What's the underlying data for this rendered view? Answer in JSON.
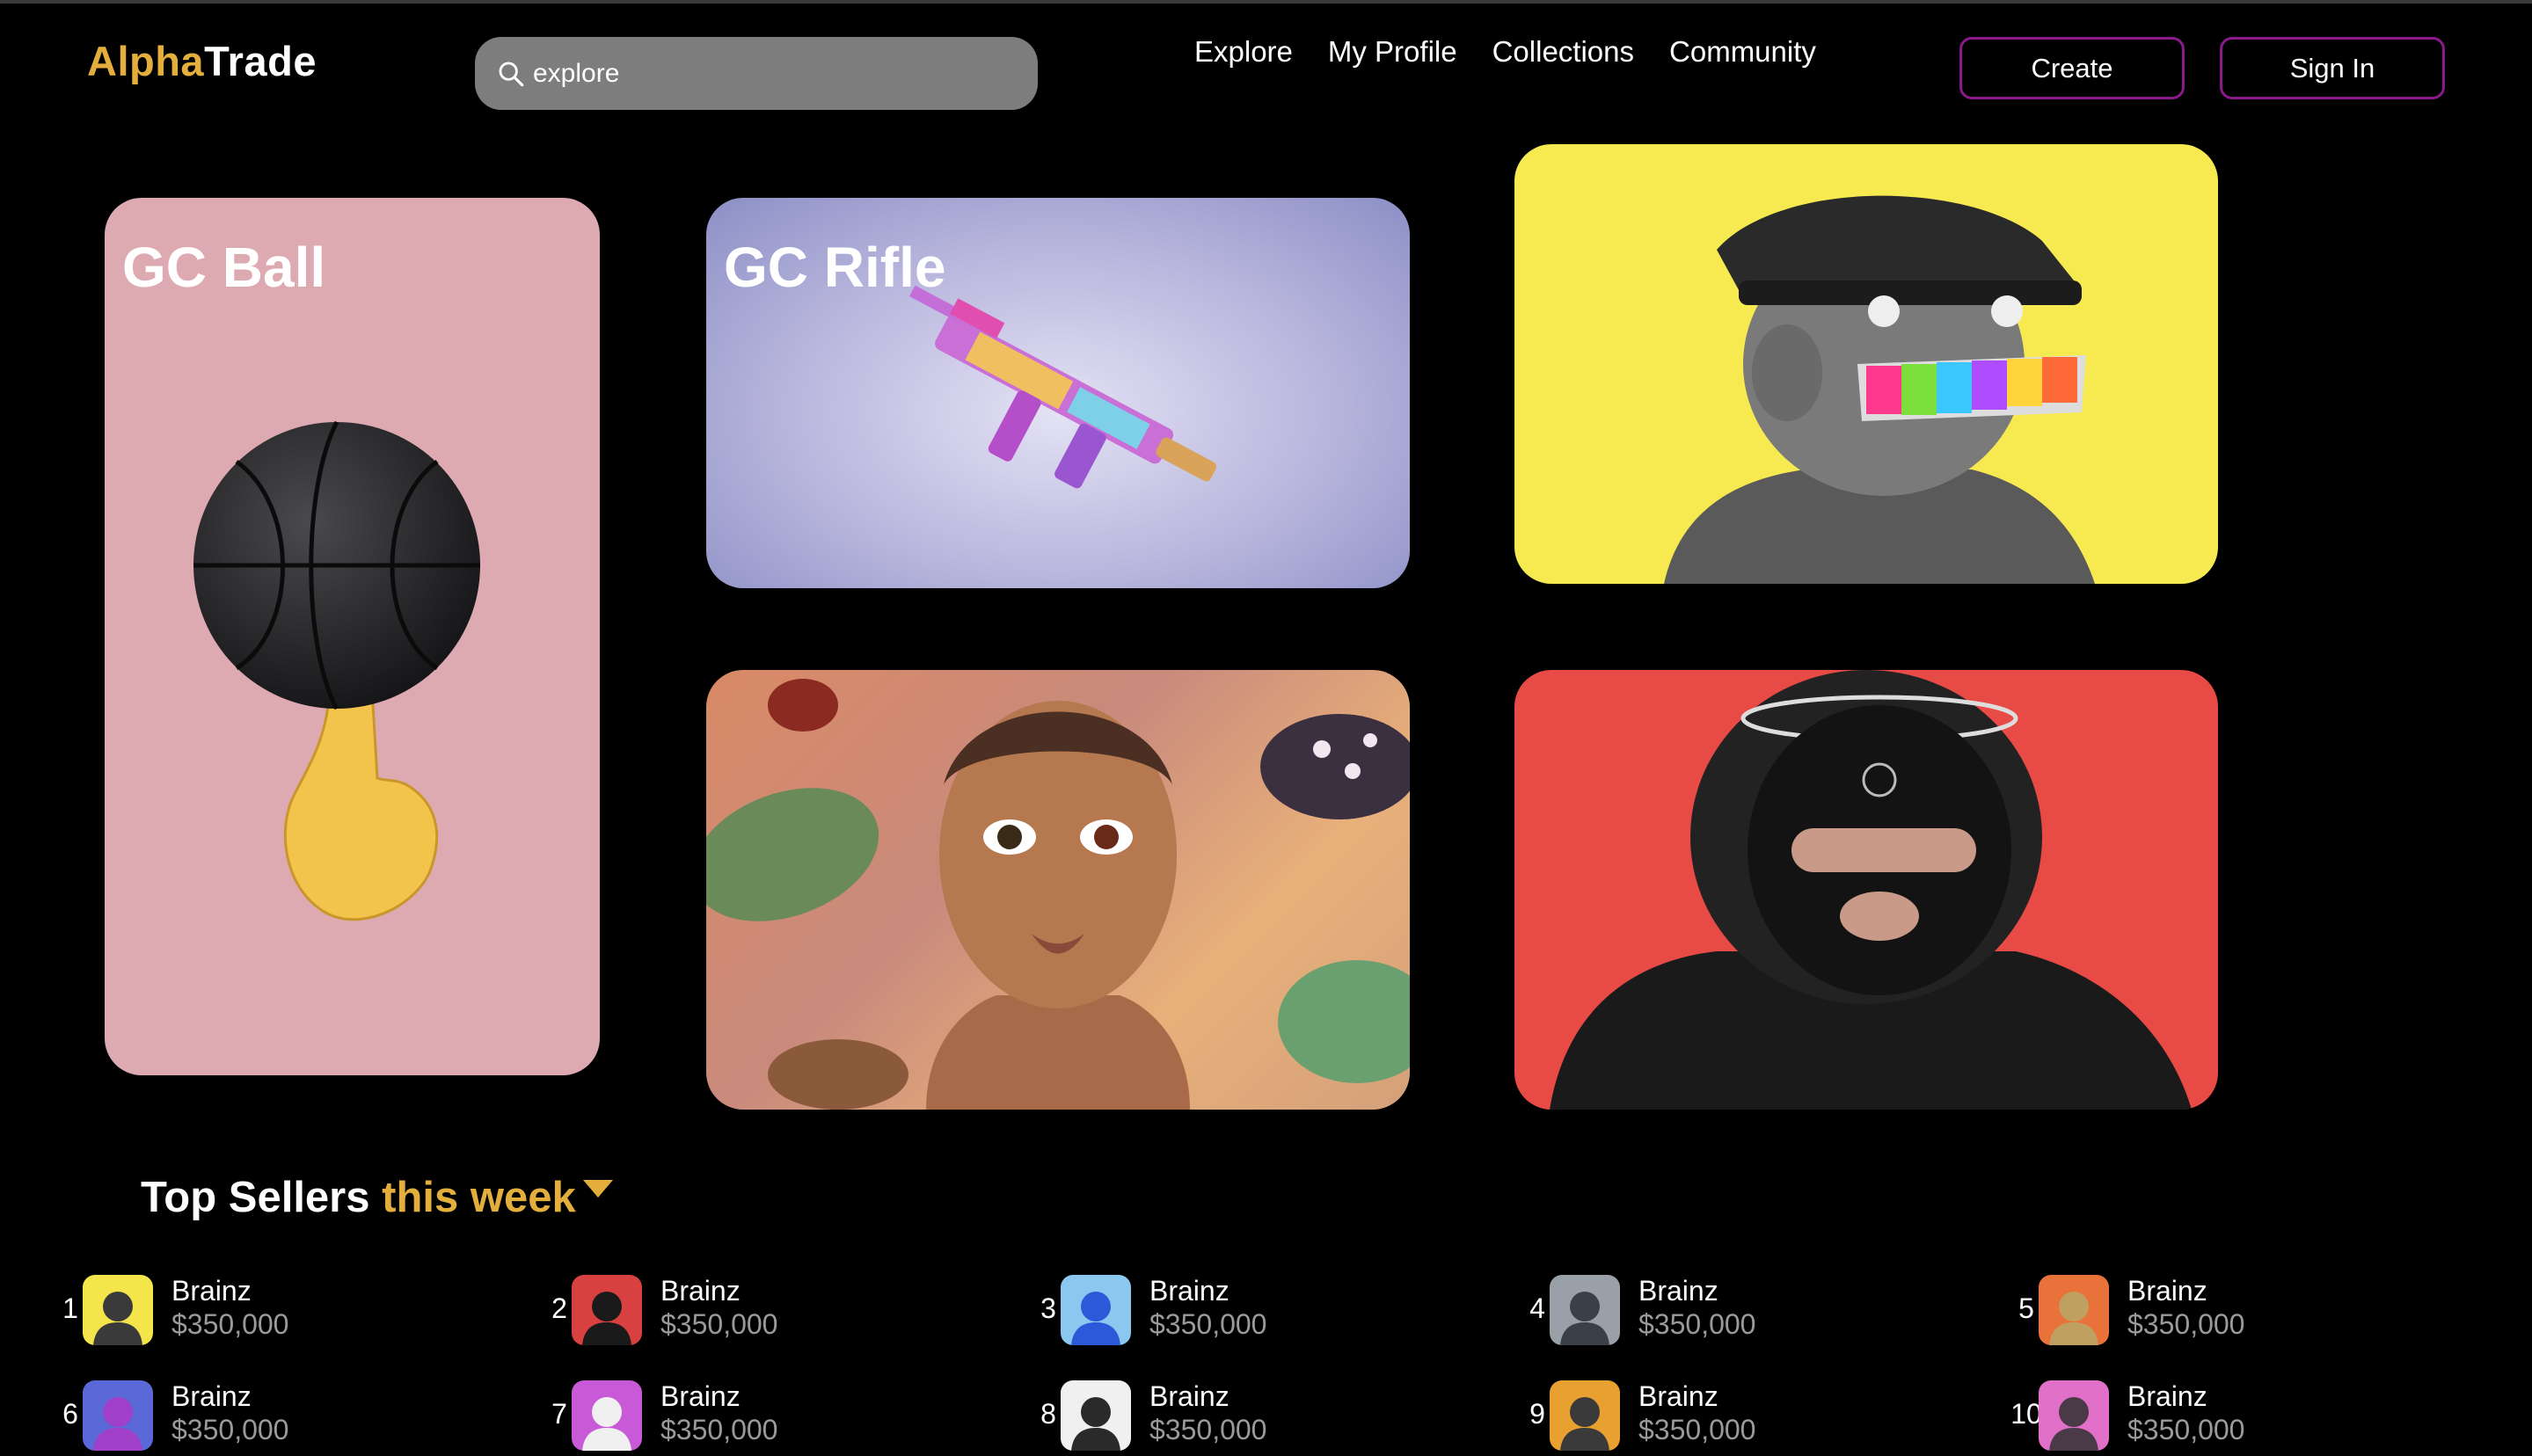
{
  "colors": {
    "accent": "#e3ae3c",
    "button_border": "#8a1a8c",
    "background": "#000000"
  },
  "header": {
    "logo_part1": "Alpha",
    "logo_part2": "Trade",
    "search": {
      "value": "explore",
      "placeholder": "explore",
      "icon": "search-icon"
    },
    "nav": [
      "Explore",
      "My Profile",
      "Collections",
      "Community"
    ],
    "create_label": "Create",
    "signin_label": "Sign In"
  },
  "featured": {
    "ball": {
      "title": "GC Ball"
    },
    "rifle": {
      "title": "GC Rifle"
    }
  },
  "top_sellers": {
    "title_main": "Top Sellers",
    "title_highlight": "this week",
    "sellers": [
      {
        "rank": "1",
        "name": "Brainz",
        "price": "$350,000"
      },
      {
        "rank": "2",
        "name": "Brainz",
        "price": "$350,000"
      },
      {
        "rank": "3",
        "name": "Brainz",
        "price": "$350,000"
      },
      {
        "rank": "4",
        "name": "Brainz",
        "price": "$350,000"
      },
      {
        "rank": "5",
        "name": "Brainz",
        "price": "$350,000"
      },
      {
        "rank": "6",
        "name": "Brainz",
        "price": "$350,000"
      },
      {
        "rank": "7",
        "name": "Brainz",
        "price": "$350,000"
      },
      {
        "rank": "8",
        "name": "Brainz",
        "price": "$350,000"
      },
      {
        "rank": "9",
        "name": "Brainz",
        "price": "$350,000"
      },
      {
        "rank": "10",
        "name": "Brainz",
        "price": "$350,000"
      }
    ]
  }
}
